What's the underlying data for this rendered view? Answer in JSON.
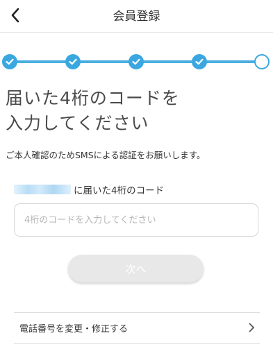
{
  "header": {
    "title": "会員登録",
    "back_icon": "chevron-left-icon"
  },
  "stepper": {
    "total_steps": 5,
    "completed_steps": 4,
    "current_step": 5,
    "accent_color": "#3aa7e0"
  },
  "main": {
    "title_line1": "届いた4桁のコードを",
    "title_line2": "入力してください",
    "subtitle": "ご本人確認のためSMSによる認証をお願いします。",
    "code_label": "に届いた4桁のコード",
    "code_input": {
      "value": "",
      "placeholder": "4桁のコードを入力してください"
    },
    "next_button": "次へ"
  },
  "footer": {
    "change_phone_label": "電話番号を変更・修正する",
    "chevron_icon": "chevron-right-icon"
  }
}
